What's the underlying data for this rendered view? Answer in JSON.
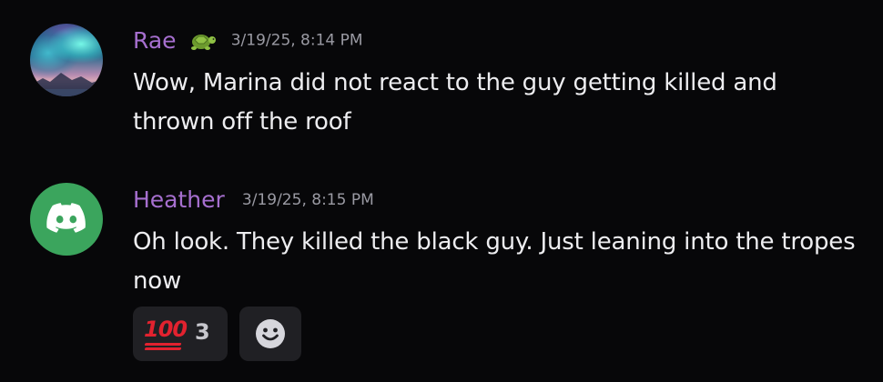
{
  "messages": [
    {
      "author": "Rae",
      "author_emoji": "turtle",
      "timestamp": "3/19/25, 8:14 PM",
      "text": "Wow, Marina did not react to the guy getting killed and thrown off the roof",
      "avatar": "aurora-landscape"
    },
    {
      "author": "Heather",
      "timestamp": "3/19/25, 8:15 PM",
      "text": "Oh look. They killed the black guy. Just leaning into the tropes now",
      "avatar": "discord-default-icon",
      "reactions": [
        {
          "emoji": "hundred-points",
          "count": "3"
        }
      ]
    }
  ],
  "colors": {
    "background": "#070709",
    "username": "#a66fcf",
    "timestamp": "#9a9aa3",
    "text": "#ededf0",
    "reaction_bg": "#202024",
    "discord_green": "#3ba55d",
    "hundred_red": "#e2222f"
  }
}
